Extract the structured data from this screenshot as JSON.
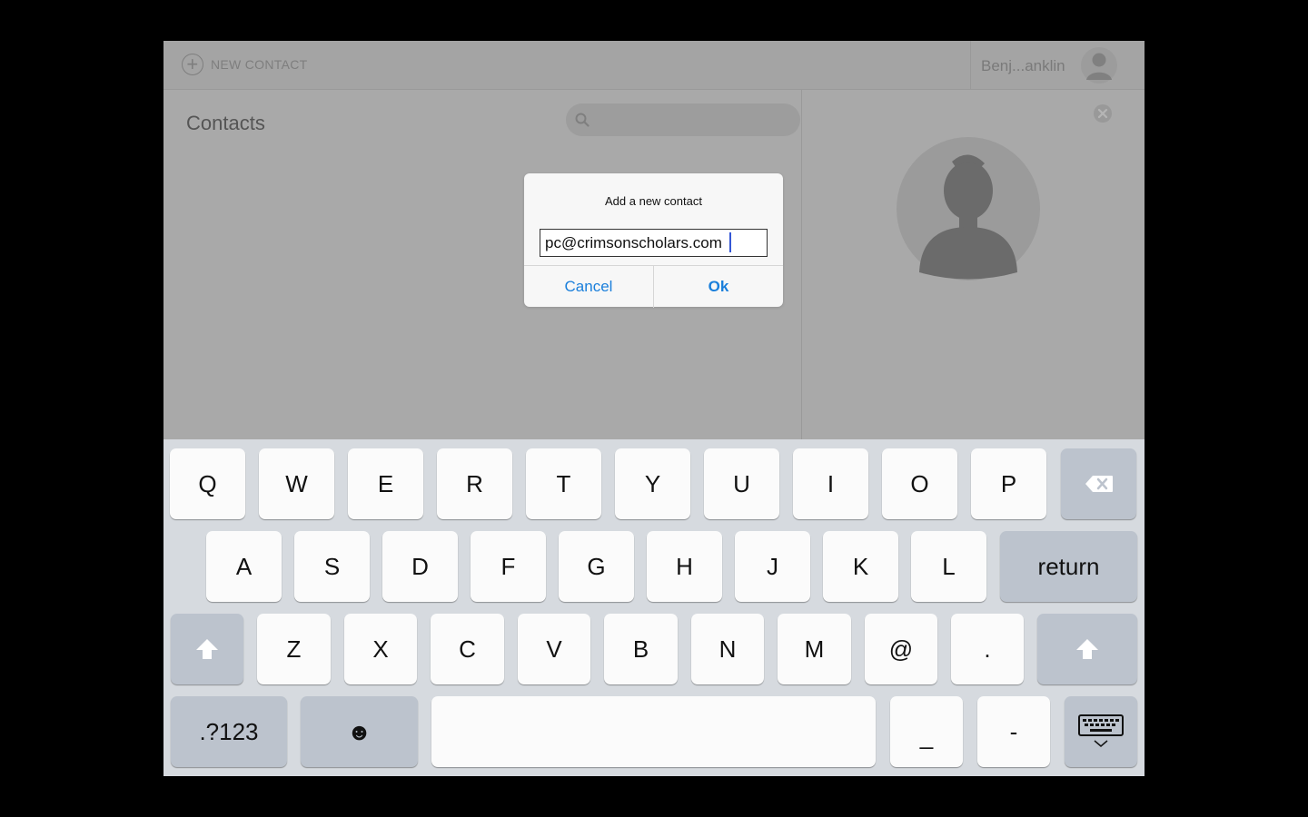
{
  "topbar": {
    "new_contact_label": "NEW CONTACT",
    "user_name": "Benj...anklin"
  },
  "contacts": {
    "title": "Contacts"
  },
  "dialog": {
    "title": "Add a new contact",
    "input_value": "pc@crimsonscholars.com",
    "cancel_label": "Cancel",
    "ok_label": "Ok"
  },
  "keyboard": {
    "row1": [
      "Q",
      "W",
      "E",
      "R",
      "T",
      "Y",
      "U",
      "I",
      "O",
      "P"
    ],
    "row2": [
      "A",
      "S",
      "D",
      "F",
      "G",
      "H",
      "J",
      "K",
      "L"
    ],
    "return_label": "return",
    "row3": [
      "Z",
      "X",
      "C",
      "V",
      "B",
      "N",
      "M",
      "@",
      "."
    ],
    "numbers_label": ".?123",
    "emoji_glyph": "☻",
    "underscore_label": "_",
    "dash_label": "-"
  },
  "colors": {
    "accent": "#1a7fdb",
    "overlay_gray": "#a9a9a9",
    "keyboard_bg": "#d6dadf"
  },
  "icons": {
    "new_contact": "plus-circle-icon",
    "avatar": "person-icon",
    "search": "search-icon",
    "close": "close-circle-icon",
    "backspace": "backspace-icon",
    "shift": "shift-icon",
    "emoji": "emoji-icon",
    "hide_keyboard": "keyboard-dismiss-icon"
  }
}
